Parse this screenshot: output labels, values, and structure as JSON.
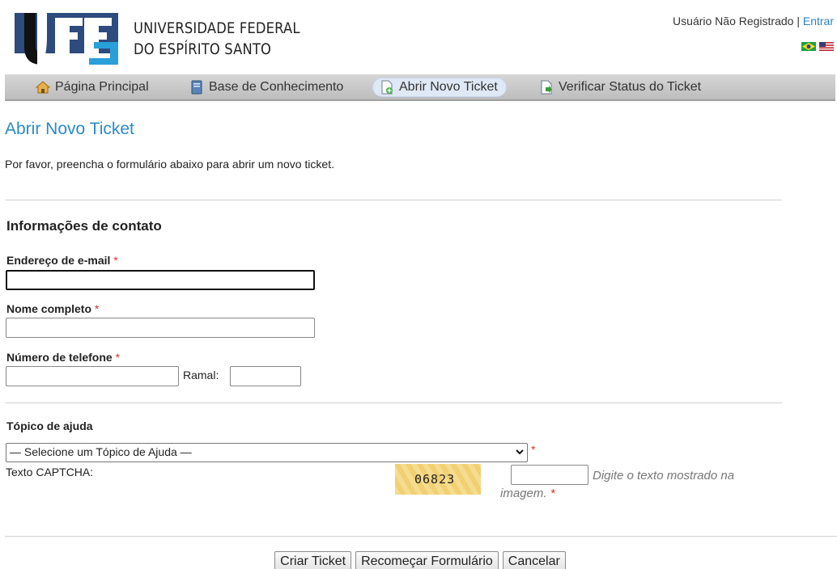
{
  "header": {
    "logo_text": "UFES",
    "university_line1": "UNIVERSIDADE FEDERAL",
    "university_line2": "DO ESPÍRITO SANTO",
    "user_status": "Usuário Não Registrado",
    "separator": "|",
    "login_link": "Entrar",
    "flags": [
      "brazil-flag-icon",
      "usa-flag-icon"
    ]
  },
  "nav": {
    "items": [
      {
        "label": "Página Principal",
        "icon": "home-icon"
      },
      {
        "label": "Base de Conhecimento",
        "icon": "book-icon"
      },
      {
        "label": "Abrir Novo Ticket",
        "icon": "new-ticket-icon",
        "active": true
      },
      {
        "label": "Verificar Status do Ticket",
        "icon": "check-status-icon"
      }
    ]
  },
  "main": {
    "title": "Abrir Novo Ticket",
    "intro": "Por favor, preencha o formulário abaixo para abrir um novo ticket.",
    "contact_section_title": "Informações de contato",
    "email_label": "Endereço de e-mail",
    "email_value": "",
    "name_label": "Nome completo",
    "name_value": "",
    "phone_label": "Número de telefone",
    "phone_value": "",
    "ext_label": "Ramal:",
    "ext_value": "",
    "required_mark": "*",
    "help_topic_title": "Tópico de ajuda",
    "help_topic_selected": "— Selecione um Tópico de Ajuda —",
    "captcha_label": "Texto CAPTCHA:",
    "captcha_code": "06823",
    "captcha_hint": "Digite o texto mostrado na imagem.",
    "captcha_value": ""
  },
  "buttons": {
    "create": "Criar Ticket",
    "reset": "Recomeçar Formulário",
    "cancel": "Cancelar"
  },
  "colors": {
    "accent": "#2a8bc8",
    "required": "#d9302b",
    "nav_bg": "#cccccc"
  }
}
